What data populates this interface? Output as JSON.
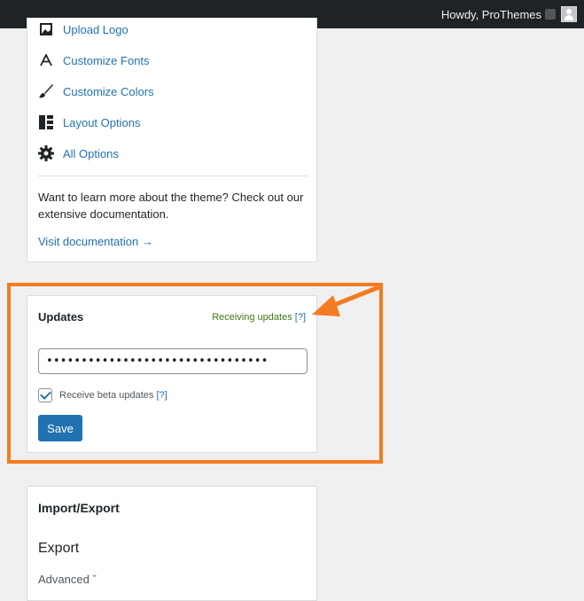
{
  "adminbar": {
    "howdy": "Howdy, ProThemes"
  },
  "theme_card": {
    "options": [
      {
        "label": "Upload Logo",
        "icon": "image-icon"
      },
      {
        "label": "Customize Fonts",
        "icon": "font-icon"
      },
      {
        "label": "Customize Colors",
        "icon": "brush-icon"
      },
      {
        "label": "Layout Options",
        "icon": "layout-icon"
      },
      {
        "label": "All Options",
        "icon": "gear-icon"
      }
    ],
    "learn_text": "Want to learn more about the theme? Check out our extensive documentation.",
    "visit_link": "Visit documentation →"
  },
  "updates": {
    "title": "Updates",
    "status": "Receiving updates",
    "status_help": "[?]",
    "key_value": "••••••••••••••••••••••••••••••••",
    "beta_label": "Receive beta updates",
    "beta_help": "[?]",
    "beta_checked": true,
    "save_label": "Save"
  },
  "import_export": {
    "title": "Import/Export",
    "export_title": "Export",
    "advanced_label": "Advanced"
  },
  "annotation": {
    "color": "#f47b20"
  }
}
